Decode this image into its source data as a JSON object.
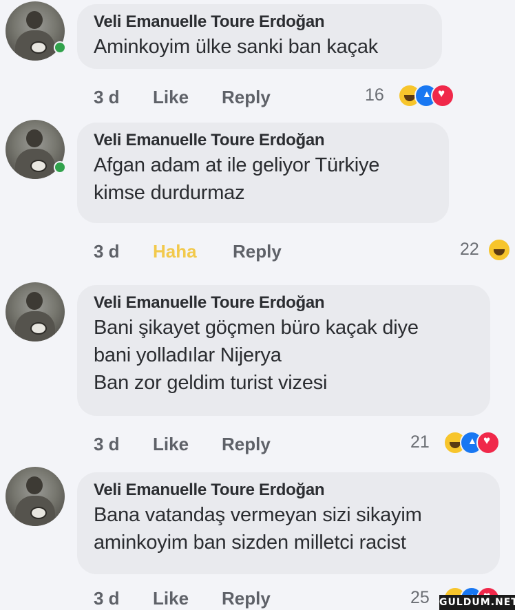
{
  "comments": [
    {
      "author": "Veli Emanuelle Toure Erdoğan",
      "lines": [
        "Aminkoyim ülke sanki ban kaçak"
      ],
      "age": "3 d",
      "react_label": "Like",
      "reply_label": "Reply",
      "count": "16",
      "reactions": [
        "haha",
        "like",
        "love"
      ],
      "online": true
    },
    {
      "author": "Veli Emanuelle Toure Erdoğan",
      "lines": [
        "Afgan adam at ile geliyor Türkiye",
        "kimse durdurmaz"
      ],
      "age": "3 d",
      "react_label": "Haha",
      "reply_label": "Reply",
      "count": "22",
      "reactions": [
        "haha"
      ],
      "online": true
    },
    {
      "author": "Veli Emanuelle Toure Erdoğan",
      "lines": [
        "Bani şikayet göçmen büro kaçak diye",
        "bani yolladılar Nijerya",
        "Ban zor geldim turist vizesi"
      ],
      "age": "3 d",
      "react_label": "Like",
      "reply_label": "Reply",
      "count": "21",
      "reactions": [
        "haha",
        "like",
        "love"
      ],
      "online": false
    },
    {
      "author": "Veli Emanuelle Toure Erdoğan",
      "lines": [
        "Bana vatandaş vermeyan sizi sikayim",
        "aminkoyim ban sizden milletci racist"
      ],
      "age": "3 d",
      "react_label": "Like",
      "reply_label": "Reply",
      "count": "25",
      "reactions": [
        "haha",
        "like",
        "love"
      ],
      "online": false
    }
  ],
  "watermark": "GULDUM.NET",
  "colors": {
    "haha_active": "#f2c94c",
    "online": "#31a24c",
    "like_blue": "#1877f2",
    "love_red": "#f0284a"
  }
}
